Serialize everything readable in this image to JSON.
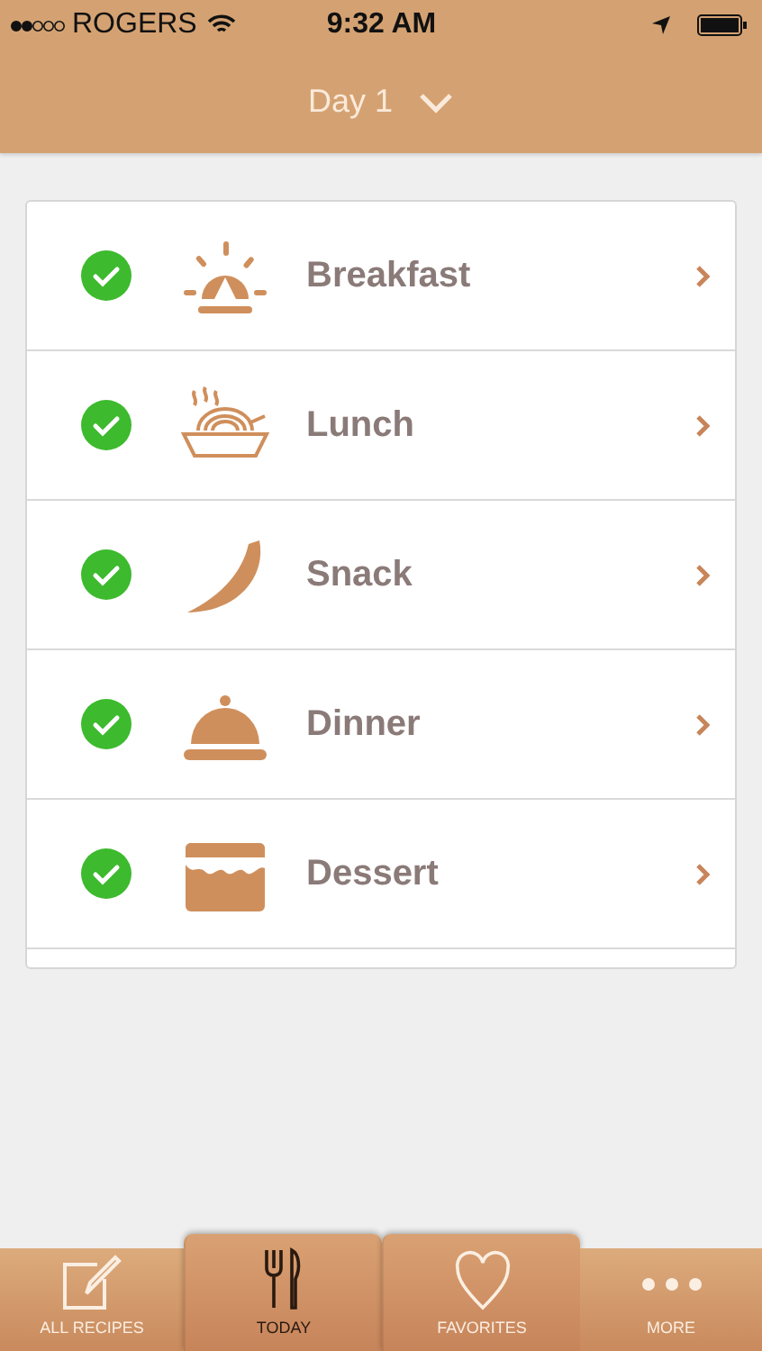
{
  "status_bar": {
    "carrier": "ROGERS",
    "time": "9:32 AM"
  },
  "nav": {
    "title": "Day 1"
  },
  "meals": [
    {
      "label": "Breakfast",
      "kind": "sunrise",
      "checked": true
    },
    {
      "label": "Lunch",
      "kind": "noodles",
      "checked": true
    },
    {
      "label": "Snack",
      "kind": "banana",
      "checked": true
    },
    {
      "label": "Dinner",
      "kind": "cloche",
      "checked": true
    },
    {
      "label": "Dessert",
      "kind": "cake",
      "checked": true
    }
  ],
  "tabs": [
    {
      "label": "ALL RECIPES",
      "kind": "edit",
      "selected": false,
      "raised": false
    },
    {
      "label": "TODAY",
      "kind": "cutlery",
      "selected": true,
      "raised": true
    },
    {
      "label": "FAVORITES",
      "kind": "heart",
      "selected": false,
      "raised": true
    },
    {
      "label": "MORE",
      "kind": "more",
      "selected": false,
      "raised": false
    }
  ]
}
